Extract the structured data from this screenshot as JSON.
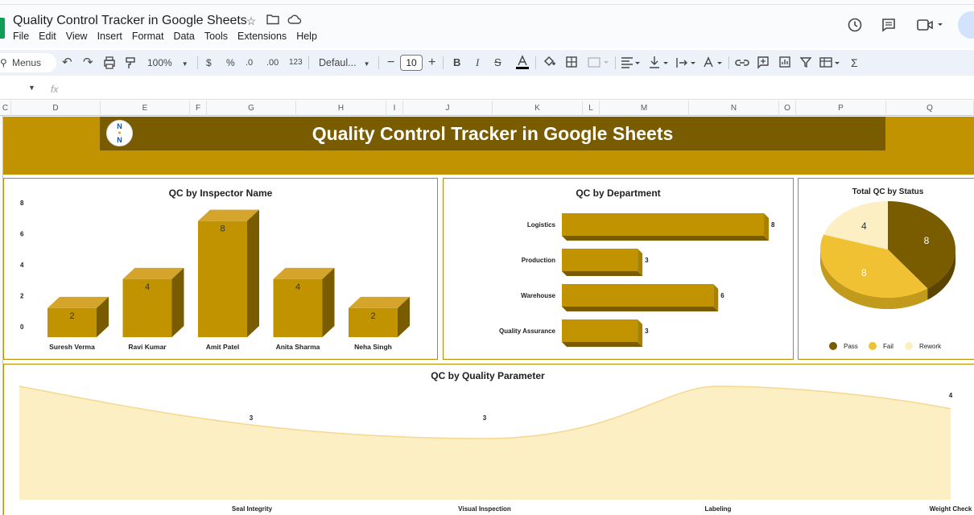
{
  "window": {
    "doc_title": "Quality Control Tracker in Google Sheets",
    "menu": [
      "File",
      "Edit",
      "View",
      "Insert",
      "Format",
      "Data",
      "Tools",
      "Extensions",
      "Help"
    ]
  },
  "toolbar": {
    "menus_label": "Menus",
    "zoom": "100%",
    "currency": "$",
    "percent": "%",
    "decrease_decimal": ".0",
    "increase_decimal": ".00",
    "number_format": "123",
    "font_name": "Defaul...",
    "font_size": "10",
    "bold": "B",
    "italic": "I"
  },
  "formula_bar": {
    "fx": "fx"
  },
  "columns": [
    "C",
    "D",
    "E",
    "F",
    "G",
    "H",
    "I",
    "J",
    "K",
    "L",
    "M",
    "N",
    "O",
    "P",
    "Q"
  ],
  "dashboard": {
    "logo_top": "N",
    "logo_bottom": "N",
    "title": "Quality Control Tracker in Google Sheets",
    "colors": {
      "dark": "#7a5c00",
      "gold": "#c29300",
      "light": "#f0c233",
      "cream": "#fdefc4"
    }
  },
  "charts": {
    "inspector": {
      "title": "QC by Inspector Name",
      "chart_data": {
        "type": "bar",
        "categories": [
          "Suresh Verma",
          "Ravi Kumar",
          "Amit Patel",
          "Anita Sharma",
          "Neha Singh"
        ],
        "values": [
          2,
          4,
          8,
          4,
          2
        ],
        "ylim": [
          0,
          8
        ],
        "yticks": [
          "0",
          "2",
          "4",
          "6",
          "8"
        ],
        "data_labels": [
          "2",
          "4",
          "8",
          "4",
          "2"
        ]
      }
    },
    "department": {
      "title": "QC by Department",
      "chart_data": {
        "type": "bar",
        "orientation": "horizontal",
        "categories": [
          "Logistics",
          "Production",
          "Warehouse",
          "Quality Assurance"
        ],
        "values": [
          8,
          3,
          6,
          3
        ],
        "data_labels": [
          "8",
          "3",
          "6",
          "3"
        ]
      }
    },
    "status": {
      "title": "Total QC by Status",
      "chart_data": {
        "type": "pie",
        "categories": [
          "Pass",
          "Fail",
          "Rework"
        ],
        "values": [
          8,
          8,
          4
        ],
        "data_labels": [
          "8",
          "8",
          "4"
        ],
        "colors": [
          "#7a5c00",
          "#f0c233",
          "#fdefc4"
        ]
      }
    },
    "parameter": {
      "title": "QC by Quality Parameter",
      "chart_data": {
        "type": "area",
        "categories": [
          "Seal Integrity",
          "Visual Inspection",
          "Labeling",
          "Weight Check"
        ],
        "values": [
          3,
          3,
          4,
          4
        ],
        "data_labels": [
          "3",
          "3",
          "4"
        ]
      }
    }
  }
}
